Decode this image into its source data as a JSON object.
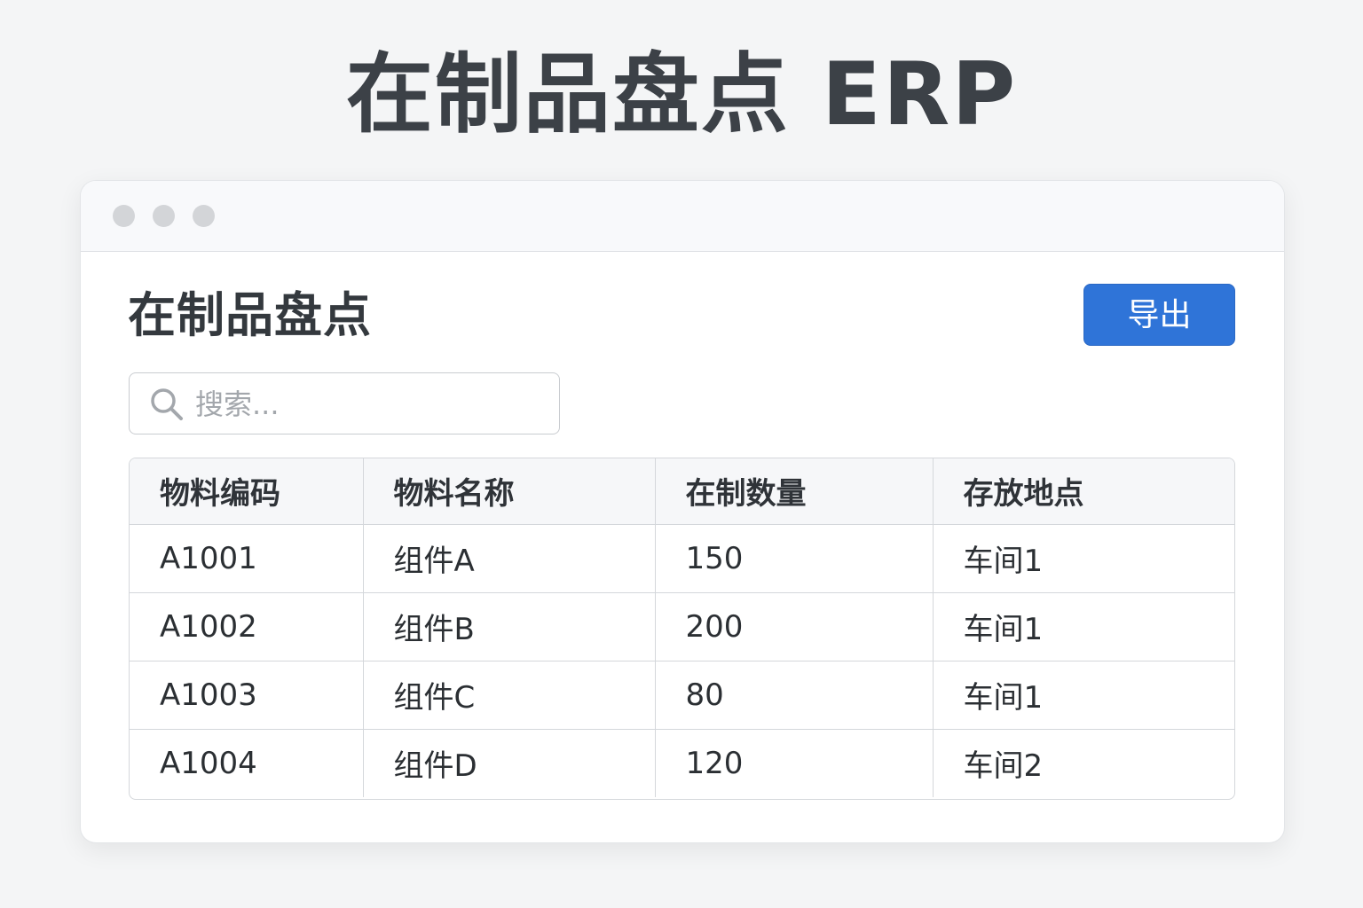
{
  "hero": {
    "title": "在制品盘点 ERP"
  },
  "window": {
    "controls": [
      "dot",
      "dot",
      "dot"
    ]
  },
  "page": {
    "title": "在制品盘点",
    "export_label": "导出"
  },
  "search": {
    "placeholder": "搜索..."
  },
  "table": {
    "columns": [
      "物料编码",
      "物料名称",
      "在制数量",
      "存放地点"
    ],
    "rows": [
      [
        "A1001",
        "组件A",
        "150",
        "车间1"
      ],
      [
        "A1002",
        "组件B",
        "200",
        "车间1"
      ],
      [
        "A1003",
        "组件C",
        "80",
        "车间1"
      ],
      [
        "A1004",
        "组件D",
        "120",
        "车间2"
      ]
    ]
  },
  "colors": {
    "accent": "#2f74d8",
    "background": "#f4f5f6",
    "window_dot": "#d3d5d8"
  },
  "icons": {
    "search": "search-icon"
  }
}
